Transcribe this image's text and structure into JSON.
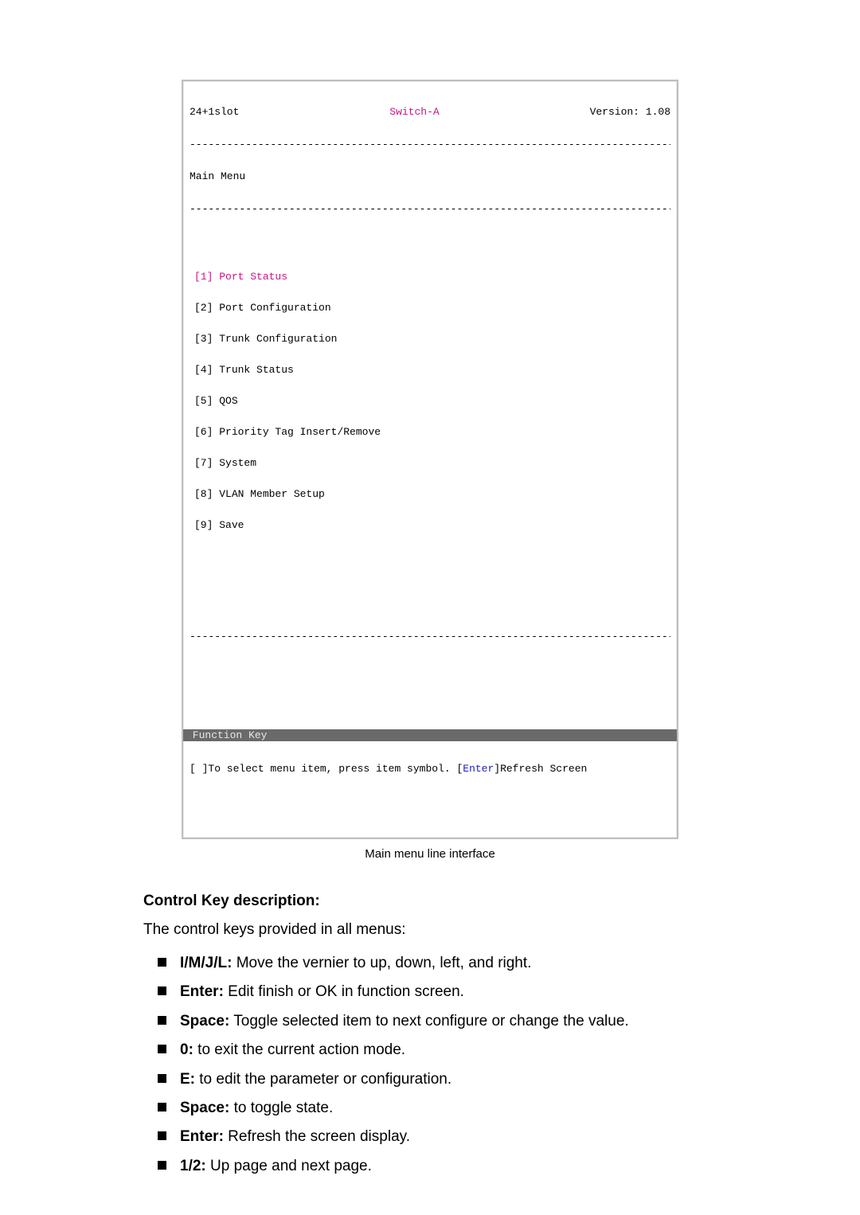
{
  "terminal": {
    "top_left": "24+1slot",
    "top_center": "Switch-A",
    "top_right": "Version: 1.08",
    "menu_title": "Main Menu",
    "items": [
      {
        "num": "[1]",
        "label": "Port Status",
        "selected": true
      },
      {
        "num": "[2]",
        "label": "Port Configuration"
      },
      {
        "num": "[3]",
        "label": "Trunk Configuration"
      },
      {
        "num": "[4]",
        "label": "Trunk Status"
      },
      {
        "num": "[5]",
        "label": "QOS"
      },
      {
        "num": "[6]",
        "label": "Priority Tag Insert/Remove"
      },
      {
        "num": "[7]",
        "label": "System"
      },
      {
        "num": "[8]",
        "label": "VLAN Member Setup"
      },
      {
        "num": "[9]",
        "label": "Save"
      }
    ],
    "func_bar": " Function Key",
    "hint_prefix": "[ ]To select menu item, press item symbol. [",
    "hint_enter": "Enter",
    "hint_suffix": "]Refresh Screen"
  },
  "caption": "Main menu line interface",
  "section": {
    "heading": "Control Key description:",
    "intro": "The control keys provided in all menus:",
    "items": [
      {
        "key": "I/M/J/L:",
        "desc": " Move the vernier to up, down, left, and right."
      },
      {
        "key": "Enter:",
        "desc": " Edit finish or OK in function screen."
      },
      {
        "key": "Space:",
        "desc": " Toggle selected item to next configure or change the value."
      },
      {
        "key": "0:",
        "desc": " to exit the current action mode."
      },
      {
        "key": "E:",
        "desc": " to edit the parameter or configuration."
      },
      {
        "key": "Space:",
        "desc": " to toggle state."
      },
      {
        "key": "Enter:",
        "desc": " Refresh the screen display."
      },
      {
        "key": "1/2:",
        "desc": " Up page and next page."
      }
    ]
  },
  "dashline": "------------------------------------------------------------------------------------------"
}
